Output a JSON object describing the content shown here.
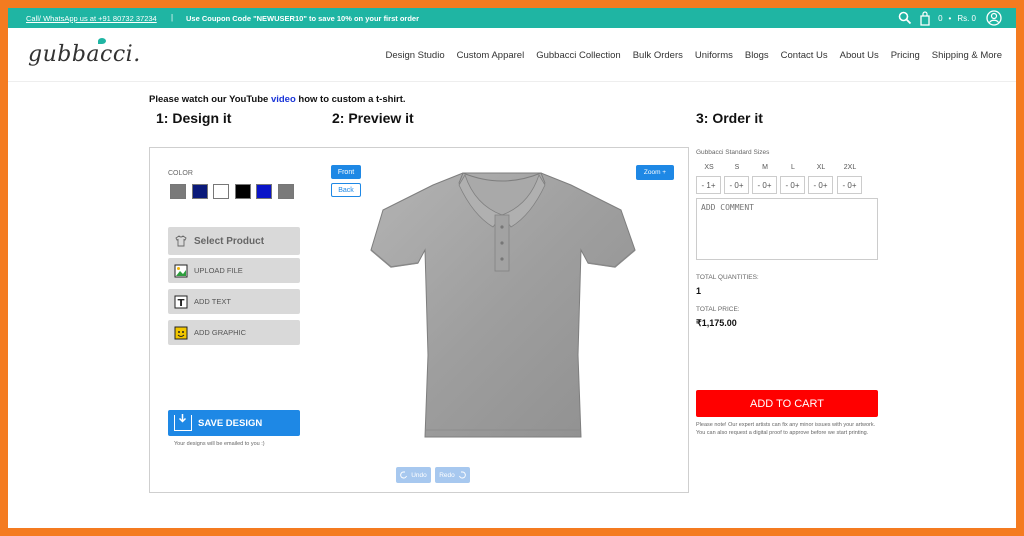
{
  "topbar": {
    "call": "Call/ WhatsApp us at +91 80732 37234",
    "separator": "|",
    "coupon": "Use Coupon Code \"NEWUSER10\" to save 10% on your first order",
    "cart_count": "0",
    "cart_dot": "•",
    "cart_total": "Rs. 0"
  },
  "logo": "gubbacci.",
  "menu": [
    "Design Studio",
    "Custom Apparel",
    "Gubbacci Collection",
    "Bulk Orders",
    "Uniforms",
    "Blogs",
    "Contact Us",
    "About Us",
    "Pricing",
    "Shipping & More"
  ],
  "intro": {
    "before": "Please watch our YouTube ",
    "link": "video",
    "after": " how to custom a t-shirt."
  },
  "steps": [
    "1: Design it",
    "2: Preview it",
    "3: Order it"
  ],
  "design": {
    "color_label": "COLOR",
    "swatches": [
      "#7a7a7a",
      "#0a1a7a",
      "#ffffff",
      "#000000",
      "#0a14c8",
      "#7a7a7a"
    ],
    "tools": [
      "Select Product",
      "UPLOAD FILE",
      "ADD TEXT",
      "ADD GRAPHIC"
    ],
    "save": "SAVE DESIGN",
    "save_note": "Your designs will be emailed to you :)"
  },
  "preview": {
    "front": "Front",
    "back": "Back",
    "zoom": "Zoom +",
    "undo": "Undo",
    "redo": "Redo",
    "shirt_color": "#a3a3a3"
  },
  "order": {
    "sizes_title": "Gubbacci Standard Sizes",
    "sizes": [
      "XS",
      "S",
      "M",
      "L",
      "XL",
      "2XL"
    ],
    "qty": [
      "- 1+",
      "- 0+",
      "- 0+",
      "- 0+",
      "- 0+",
      "- 0+"
    ],
    "comment_placeholder": "ADD COMMENT",
    "total_qty_label": "TOTAL QUANTITIES:",
    "total_qty": "1",
    "total_price_label": "TOTAL PRICE:",
    "total_price": "₹1,175.00",
    "add_to_cart": "ADD TO CART",
    "note": "Please note! Our expert artists can fix any minor issues with your artwork. You can also request a digital proof to approve before we start printing."
  },
  "colors": {
    "teal": "#1fb5a3",
    "blue": "#1e88e5",
    "red": "#ff0000",
    "border": "#f47b20"
  }
}
